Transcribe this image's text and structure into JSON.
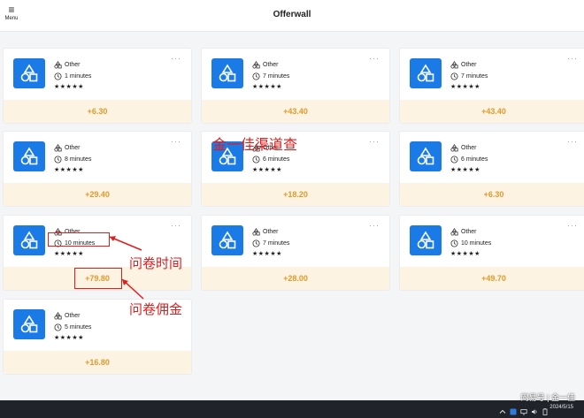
{
  "header": {
    "menu_label": "Menu",
    "title": "Offerwall"
  },
  "offers": [
    {
      "category": "Other",
      "duration": "1 minutes",
      "stars": "★★★★★",
      "reward": "+6.30"
    },
    {
      "category": "Other",
      "duration": "7 minutes",
      "stars": "★★★★★",
      "reward": "+43.40"
    },
    {
      "category": "Other",
      "duration": "7 minutes",
      "stars": "★★★★★",
      "reward": "+43.40"
    },
    {
      "category": "Other",
      "duration": "8 minutes",
      "stars": "★★★★★",
      "reward": "+29.40"
    },
    {
      "category": "Other",
      "duration": "6 minutes",
      "stars": "★★★★★",
      "reward": "+18.20"
    },
    {
      "category": "Other",
      "duration": "6 minutes",
      "stars": "★★★★★",
      "reward": "+6.30"
    },
    {
      "category": "Other",
      "duration": "10 minutes",
      "stars": "★★★★★",
      "reward": "+79.80"
    },
    {
      "category": "Other",
      "duration": "7 minutes",
      "stars": "★★★★★",
      "reward": "+28.00"
    },
    {
      "category": "Other",
      "duration": "10 minutes",
      "stars": "★★★★★",
      "reward": "+49.70"
    },
    {
      "category": "Other",
      "duration": "5 minutes",
      "stars": "★★★★★",
      "reward": "+16.80"
    }
  ],
  "annotations": {
    "watermark": "金一佳渠道查",
    "time_label": "问卷时间",
    "commission_label": "问卷佣金",
    "color": "#e31c1c"
  },
  "taskbar": {
    "date": "2024/5/15",
    "brand_overlay": "网易号 | 金一佳"
  },
  "colors": {
    "accent": "#1a7ae6",
    "reward_text": "#e09a2a",
    "reward_bg": "#fdf3e2"
  }
}
